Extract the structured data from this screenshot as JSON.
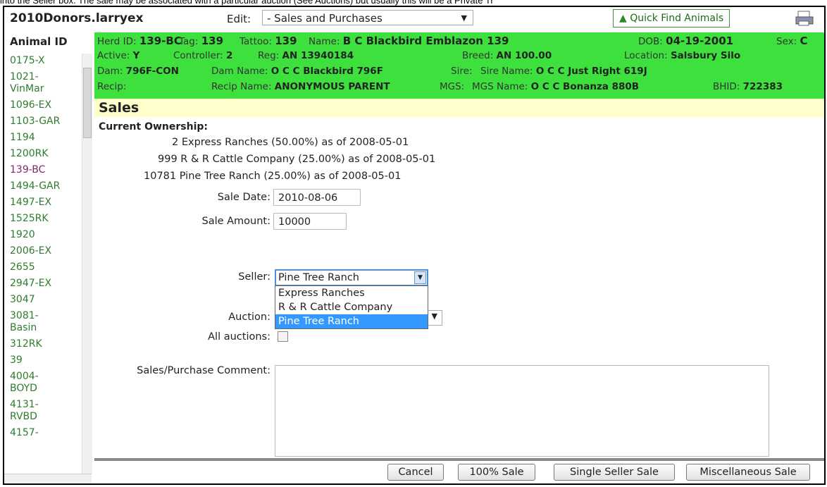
{
  "caption": "into the Seller box.  The sale may be associated with a particular auction (See Auctions) but usually this will be a Private Tr",
  "app": {
    "file_title": "2010Donors.larryex",
    "edit_label": "Edit:",
    "edit_value": "- Sales and Purchases",
    "quick_find": "Quick Find Animals"
  },
  "sidebar": {
    "header": "Animal ID",
    "items": [
      "0175-X",
      "1021-\nVinMar",
      "1096-EX",
      "1103-GAR",
      "1194",
      "1200RK",
      "139-BC",
      "1494-GAR",
      "1497-EX",
      "1525RK",
      "1920",
      "2006-EX",
      "2655",
      "2947-EX",
      "3047",
      "3081-\nBasin",
      "312RK",
      "39",
      "4004-\nBOYD",
      "4131-\nRVBD",
      "4157-"
    ]
  },
  "animal": {
    "herd_id_label": "Herd ID:",
    "herd_id": "139-BC",
    "tag_label": "Tag:",
    "tag": "139",
    "tattoo_label": "Tattoo:",
    "tattoo": "139",
    "name_label": "Name:",
    "name": "B C Blackbird Emblazon 139",
    "dob_label": "DOB:",
    "dob": "04-19-2001",
    "sex_label": "Sex:",
    "sex": "C",
    "active_label": "Active:",
    "active": "Y",
    "controller_label": "Controller:",
    "controller": "2",
    "reg_label": "Reg:",
    "reg": "AN 13940184",
    "breed_label": "Breed:",
    "breed": "AN 100.00",
    "location_label": "Location:",
    "location": "Salsbury Silo",
    "dam_label": "Dam:",
    "dam": "796F-CON",
    "dam_name_label": "Dam Name:",
    "dam_name": "O C C Blackbird 796F",
    "sire_label": "Sire:",
    "sire_name_label": "Sire Name:",
    "sire_name": "O C C Just Right 619J",
    "recip_label": "Recip:",
    "recip_name_label": "Recip Name:",
    "recip_name": "ANONYMOUS PARENT",
    "mgs_label": "MGS:",
    "mgs_name_label": "MGS Name:",
    "mgs_name": "O C C Bonanza 880B",
    "bhid_label": "BHID:",
    "bhid": "722383"
  },
  "sales": {
    "title": "Sales",
    "ownership_header": "Current Ownership:",
    "owners": [
      "2 Express Ranches (50.00%) as of 2008-05-01",
      "999 R & R Cattle Company (25.00%) as of 2008-05-01",
      "10781 Pine Tree Ranch (25.00%) as of 2008-05-01"
    ],
    "sale_date_label": "Sale Date:",
    "sale_date": "2010-08-06",
    "sale_amount_label": "Sale Amount:",
    "sale_amount": "10000",
    "seller_label": "Seller:",
    "seller_value": "Pine Tree Ranch",
    "seller_options": [
      "Express Ranches",
      "R & R Cattle Company",
      "Pine Tree Ranch"
    ],
    "auction_label": "Auction:",
    "all_auctions_label": "All auctions:",
    "comment_label": "Sales/Purchase Comment:"
  },
  "buttons": {
    "cancel": "Cancel",
    "full_sale": "100% Sale",
    "single_seller": "Single Seller Sale",
    "misc_sale": "Miscellaneous Sale"
  }
}
